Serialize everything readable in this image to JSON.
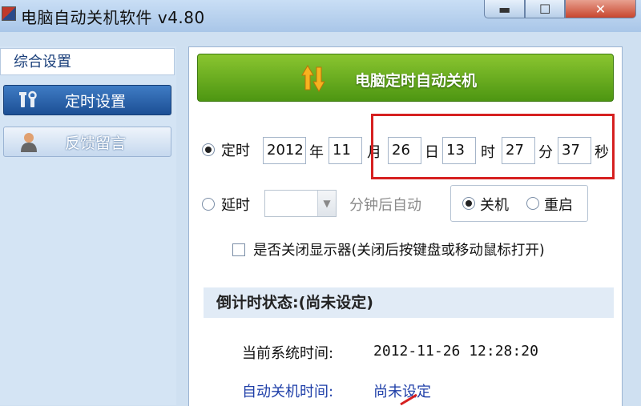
{
  "window": {
    "title": "电脑自动关机软件 v4.80",
    "min_glyph": "▬",
    "max_glyph": "☐",
    "close_glyph": "✕"
  },
  "sidebar": {
    "header": "综合设置",
    "items": [
      {
        "label": "定时设置",
        "icon": "tools-icon",
        "active": true
      },
      {
        "label": "反馈留言",
        "icon": "user-icon",
        "active": false
      }
    ]
  },
  "banner": {
    "title": "电脑定时自动关机",
    "icon": "up-down-arrows-icon"
  },
  "timer": {
    "mode_label": "定时",
    "year": "2012",
    "year_unit": "年",
    "month": "11",
    "month_unit": "月",
    "day": "26",
    "day_unit": "日",
    "hour": "13",
    "hour_unit": "时",
    "minute": "27",
    "minute_unit": "分",
    "second": "37",
    "second_unit": "秒",
    "checked": true
  },
  "delay": {
    "mode_label": "延时",
    "value": "",
    "suffix": "分钟后自动",
    "checked": false,
    "actions": [
      {
        "label": "关机",
        "checked": true
      },
      {
        "label": "重启",
        "checked": false
      }
    ]
  },
  "monitor": {
    "label": "是否关闭显示器(关闭后按键盘或移动鼠标打开)",
    "checked": false
  },
  "status": {
    "header": "倒计时状态:(尚未设定)",
    "system_time_label": "当前系统时间:",
    "system_time_value": "2012-11-26 12:28:20",
    "shutdown_time_label": "自动关机时间:",
    "shutdown_time_value": "尚未设定"
  },
  "colors": {
    "highlight_box": "#d62020",
    "banner_green": "#6cb025",
    "sidebar_active": "#2a5fa8"
  }
}
